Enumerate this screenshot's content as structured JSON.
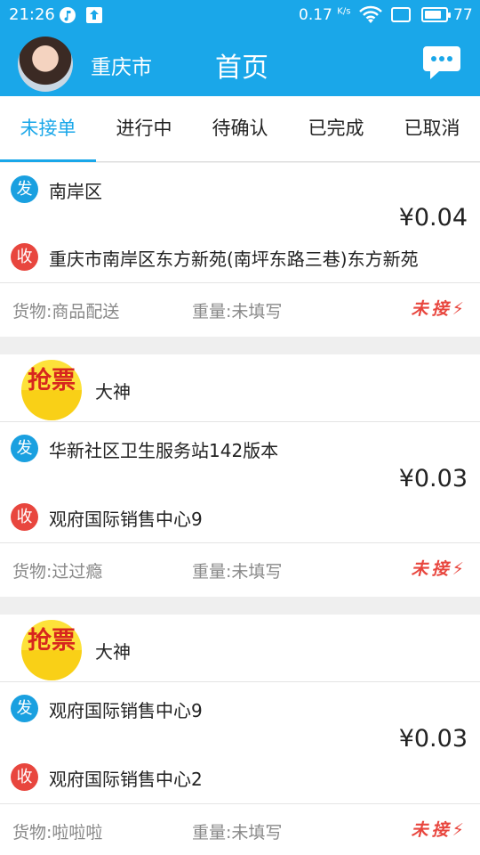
{
  "status_bar": {
    "time": "21:26",
    "net_speed": "0.17",
    "speed_unit": "K/s",
    "battery": "77"
  },
  "header": {
    "city": "重庆市",
    "title": "首页"
  },
  "tabs": [
    {
      "label": "未接单",
      "active": true
    },
    {
      "label": "进行中",
      "active": false
    },
    {
      "label": "待确认",
      "active": false
    },
    {
      "label": "已完成",
      "active": false
    },
    {
      "label": "已取消",
      "active": false
    }
  ],
  "orders": [
    {
      "poster": "",
      "send_tag": "发",
      "from": "南岸区",
      "price": "¥0.04",
      "recv_tag": "收",
      "to": "重庆市南岸区东方新苑(南坪东路三巷)东方新苑",
      "goods": "货物:商品配送",
      "weight": "重量:未填写",
      "status": "未接"
    },
    {
      "poster": "大神",
      "badge": "抢票",
      "send_tag": "发",
      "from": "华新社区卫生服务站142版本",
      "price": "¥0.03",
      "recv_tag": "收",
      "to": "观府国际销售中心9",
      "goods": "货物:过过瘾",
      "weight": "重量:未填写",
      "status": "未接"
    },
    {
      "poster": "大神",
      "badge": "抢票",
      "send_tag": "发",
      "from": "观府国际销售中心9",
      "price": "¥0.03",
      "recv_tag": "收",
      "to": "观府国际销售中心2",
      "goods": "货物:啦啦啦",
      "weight": "重量:未填写",
      "status": "未接"
    }
  ]
}
